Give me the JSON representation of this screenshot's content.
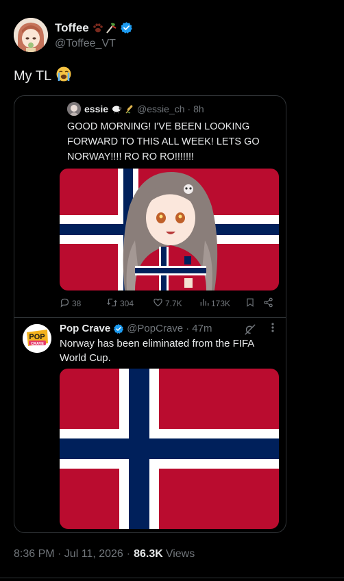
{
  "author": {
    "display_name": "Toffee",
    "handle": "@Toffee_VT",
    "emoji_icons": [
      "paw-print-icon",
      "candy-stick-icon"
    ],
    "verified": true
  },
  "tweet": {
    "text": "My TL",
    "emoji_icon": "loudly-crying-face-icon"
  },
  "quoted_tweet": {
    "display_name": "essie",
    "emoji_icons": [
      "sheep-icon",
      "wheat-icon"
    ],
    "handle": "@essie_ch",
    "time": "· 8h",
    "text": "GOOD MORNING! I'VE BEEN LOOKING FORWARD TO THIS ALL WEEK! LETS GO NORWAY!!!! RO RO RO!!!!!!!",
    "media": "vtuber-character-in-norway-jersey-over-norway-flag",
    "actions": {
      "replies": "38",
      "reposts": "304",
      "likes": "7.7K",
      "views": "173K"
    }
  },
  "nested_tweet": {
    "display_name": "Pop Crave",
    "avatar_text_top": "POP",
    "avatar_text_bottom": "CRAVE",
    "verified": true,
    "handle": "@PopCrave",
    "time": "· 47m",
    "text": "Norway has been eliminated from the FIFA World Cup.",
    "media": "norway-flag"
  },
  "meta": {
    "timestamp": "8:36 PM · Jul 11, 2026",
    "separator": "·",
    "views_count": "86.3K",
    "views_label": "Views"
  },
  "colors": {
    "background": "#000000",
    "text": "#e7e9ea",
    "muted": "#71767b",
    "border": "#2f3336",
    "verified": "#1d9bf0",
    "flag_red": "#ba0c2f",
    "flag_blue": "#00205b"
  }
}
